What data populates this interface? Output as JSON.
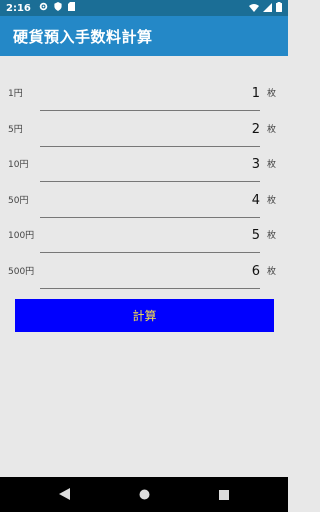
{
  "status_bar": {
    "time": "2:16",
    "icons": [
      "gear-icon",
      "shield-icon",
      "sdcard-icon",
      "wifi-icon",
      "signal-icon",
      "battery-icon"
    ]
  },
  "app_bar": {
    "title": "硬貨預入手数料計算"
  },
  "rows": [
    {
      "label": "1円",
      "value": "1",
      "unit": "枚"
    },
    {
      "label": "5円",
      "value": "2",
      "unit": "枚"
    },
    {
      "label": "10円",
      "value": "3",
      "unit": "枚"
    },
    {
      "label": "50円",
      "value": "4",
      "unit": "枚"
    },
    {
      "label": "100円",
      "value": "5",
      "unit": "枚"
    },
    {
      "label": "500円",
      "value": "6",
      "unit": "枚"
    }
  ],
  "calculate_button": {
    "label": "計算"
  },
  "colors": {
    "status_bar": "#1b6e96",
    "app_bar": "#2488c7",
    "button_bg": "#0000ff",
    "button_text": "#f7e14a",
    "background": "#e8e8e8"
  },
  "nav_bar": {
    "icons": [
      "back-icon",
      "home-icon",
      "recents-icon"
    ]
  }
}
